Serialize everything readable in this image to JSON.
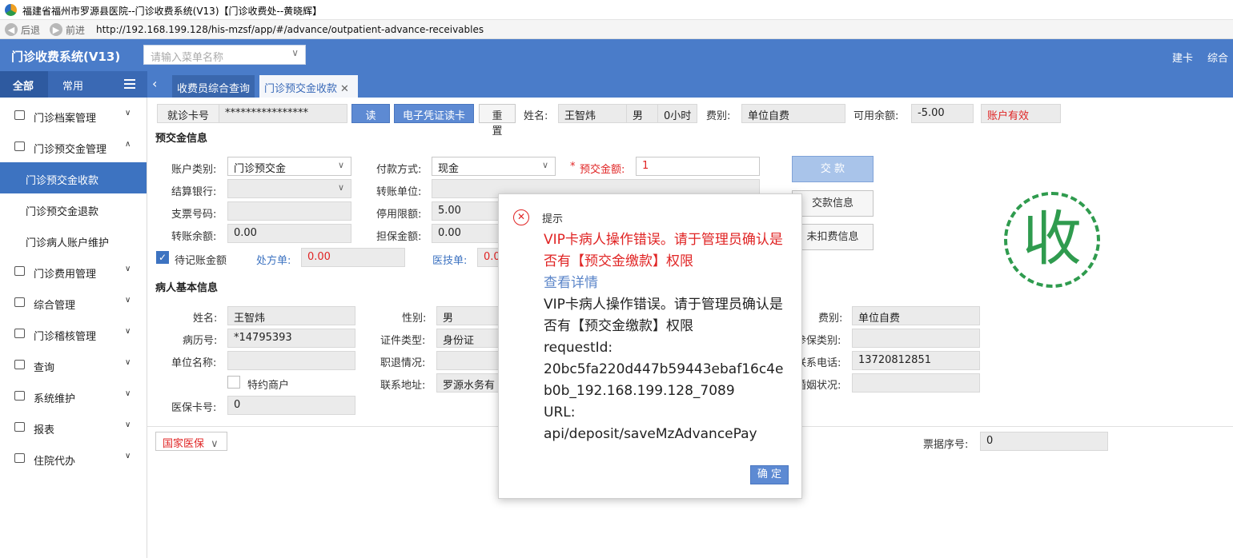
{
  "window": {
    "title": "福建省福州市罗源县医院--门诊收费系统(V13)【门诊收费处--黄晓辉】",
    "back": "后退",
    "forward": "前进",
    "url": "http://192.168.199.128/his-mzsf/app/#/advance/outpatient-advance-receivables"
  },
  "topbar": {
    "app_name": "门诊收费系统(V13)",
    "menu_search_placeholder": "请输入菜单名称",
    "links": [
      "建卡",
      "综合"
    ]
  },
  "sidebar": {
    "tabs": [
      "全部",
      "常用"
    ],
    "items": [
      {
        "label": "门诊档案管理",
        "icon": "archive-icon"
      },
      {
        "label": "门诊预交金管理",
        "icon": "deposit-icon",
        "expanded": true,
        "children": [
          {
            "label": "门诊预交金收款",
            "active": true
          },
          {
            "label": "门诊预交金退款"
          },
          {
            "label": "门诊病人账户维护"
          }
        ]
      },
      {
        "label": "门诊费用管理",
        "icon": "fee-icon"
      },
      {
        "label": "综合管理",
        "icon": "manage-icon"
      },
      {
        "label": "门诊稽核管理",
        "icon": "audit-icon"
      },
      {
        "label": "查询",
        "icon": "query-icon"
      },
      {
        "label": "系统维护",
        "icon": "system-icon"
      },
      {
        "label": "报表",
        "icon": "report-icon"
      },
      {
        "label": "住院代办",
        "icon": "inpatient-icon"
      }
    ]
  },
  "tabs": [
    "收费员综合查询",
    "门诊预交金收款"
  ],
  "cardbar": {
    "card_label": "就诊卡号",
    "card_value": "****************",
    "read_card": "读 卡",
    "e_read": "电子凭证读卡",
    "reset": "重 置",
    "name_label": "姓名:",
    "name": "王智炜",
    "sex": "男",
    "age": "0小时",
    "fee_type_label": "费别:",
    "fee_type": "单位自费",
    "balance_label": "可用余额:",
    "balance": "-5.00",
    "account_status": "账户有效"
  },
  "deposit": {
    "section": "预交金信息",
    "account_type_label": "账户类别:",
    "account_type": "门诊预交金",
    "pay_method_label": "付款方式:",
    "pay_method": "现金",
    "amount_label": "预交金额:",
    "amount": "1",
    "bank_label": "结算银行:",
    "bank": "",
    "transfer_unit_label": "转账单位:",
    "cheque_label": "支票号码:",
    "stop_limit_label": "停用限额:",
    "stop_limit": "5.00",
    "transfer_balance_label": "转账余额:",
    "transfer_balance": "0.00",
    "guarantee_label": "担保金额:",
    "guarantee": "0.00",
    "pending_label": "待记账金额",
    "rx_label": "处方单:",
    "rx": "0.00",
    "tech_label": "医技单:",
    "tech": "0.0",
    "pay_btn": "交 款",
    "pay_info_btn": "交款信息",
    "undeducted_btn": "未扣费信息",
    "stamp": "收"
  },
  "patient": {
    "section": "病人基本信息",
    "name_label": "姓名:",
    "name": "王智炜",
    "sex_label": "性别:",
    "sex": "男",
    "fee_label": "费别:",
    "fee": "单位自费",
    "record_label": "病历号:",
    "record": "*14795393",
    "id_type_label": "证件类型:",
    "id_type": "身份证",
    "insure_label": "参保类别:",
    "unit_label": "单位名称:",
    "retire_label": "职退情况:",
    "phone_label": "联系电话:",
    "phone": "13720812851",
    "special_label": "特约商户",
    "address_label": "联系地址:",
    "address": "罗源水务有",
    "marriage_label": "婚姻状况:",
    "medcard_label": "医保卡号:",
    "medcard": "0"
  },
  "bottom": {
    "national_insurance": "国家医保",
    "ticket_label": "票据序号:",
    "ticket": "0"
  },
  "dialog": {
    "title": "提示",
    "error": "VIP卡病人操作错误。请于管理员确认是否有【预交金缴款】权限",
    "details_link": "查看详情",
    "detail_lines": [
      "VIP卡病人操作错误。请于管理员确认是否有【预交金缴款】权限",
      "requestId:",
      "20bc5fa220d447b59443ebaf16c4eb0b_192.168.199.128_7089",
      "URL:",
      "api/deposit/saveMzAdvancePay"
    ],
    "ok": "确 定"
  },
  "colors": {
    "primary": "#4a7cc9",
    "active_menu": "#3d73c1",
    "error": "#e02424",
    "stamp": "#2f9b4e"
  }
}
